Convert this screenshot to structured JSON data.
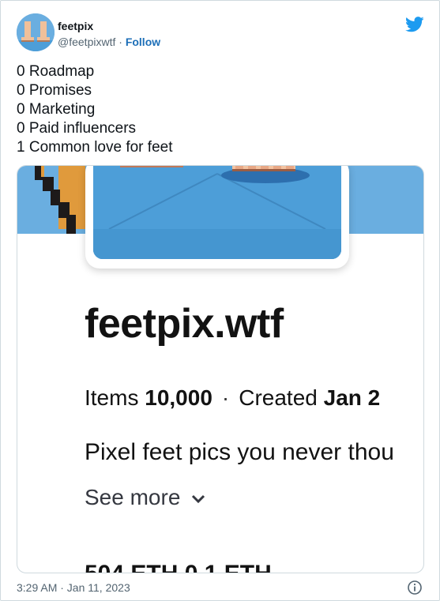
{
  "user": {
    "name": "feetpix",
    "handle": "@feetpixwtf",
    "separator": " · ",
    "follow_label": "Follow"
  },
  "tweet": {
    "lines": [
      "0 Roadmap",
      "0 Promises",
      "0 Marketing",
      "0 Paid influencers",
      "1 Common love for feet"
    ]
  },
  "media": {
    "collection_title": "feetpix.wtf",
    "items_label": "Items",
    "items_value": "10,000",
    "meta_separator": "·",
    "created_label": "Created",
    "created_value": "Jan 2",
    "description": "Pixel feet pics you never thou",
    "see_more": "See more",
    "cut_off_stats": "504 ETH        0.1 ETH"
  },
  "footer": {
    "timestamp": "3:29 AM · Jan 11, 2023"
  },
  "icons": {
    "brand": "twitter-bird-icon",
    "info": "info-icon",
    "chevron": "chevron-down-icon"
  },
  "colors": {
    "twitter_blue": "#1d9bf0",
    "follow_link": "#1d6fb8",
    "banner_blue": "#6aaee0",
    "logo_blue": "#4d9ed8"
  }
}
